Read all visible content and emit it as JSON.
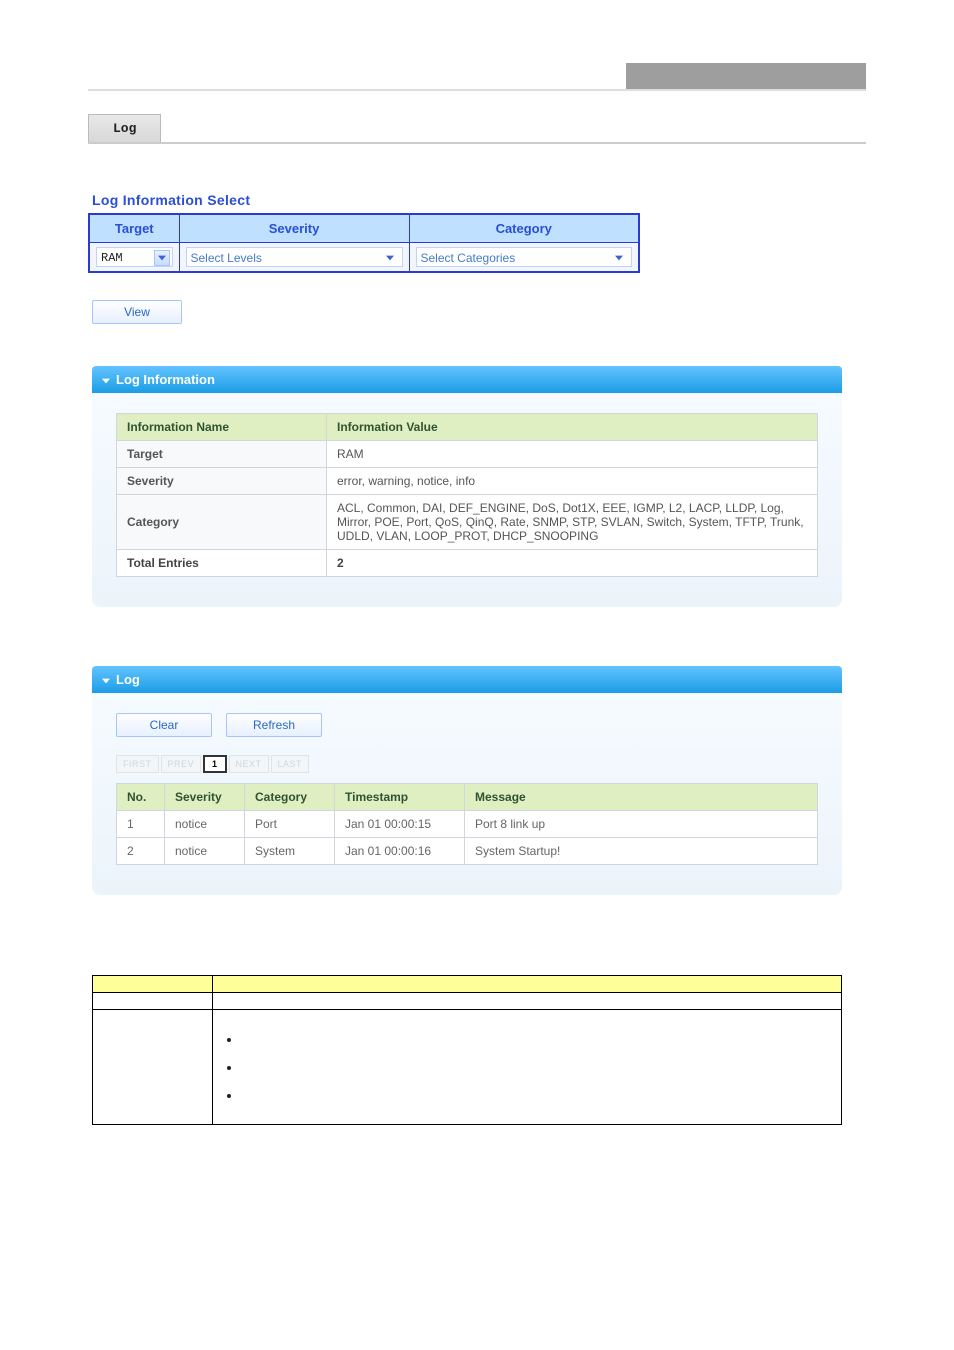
{
  "tab": {
    "label": "Log"
  },
  "logSelect": {
    "title": "Log Information Select",
    "headers": {
      "target": "Target",
      "severity": "Severity",
      "category": "Category"
    },
    "targetValue": "RAM",
    "severityPlaceholder": "Select Levels",
    "categoryPlaceholder": "Select Categories",
    "viewLabel": "View"
  },
  "infoPanel": {
    "title": "Log Information",
    "headers": {
      "name": "Information Name",
      "value": "Information Value"
    },
    "rows": [
      {
        "name": "Target",
        "value": "RAM"
      },
      {
        "name": "Severity",
        "value": "error, warning, notice, info"
      },
      {
        "name": "Category",
        "value": "ACL, Common, DAI, DEF_ENGINE, DoS, Dot1X, EEE, IGMP, L2, LACP, LLDP, Log, Mirror, POE, Port, QoS, QinQ, Rate, SNMP, STP, SVLAN, Switch, System, TFTP, Trunk, UDLD, VLAN, LOOP_PROT, DHCP_SNOOPING"
      }
    ],
    "totalLabel": "Total Entries",
    "totalValue": "2"
  },
  "logPanel": {
    "title": "Log",
    "clearLabel": "Clear",
    "refreshLabel": "Refresh",
    "pager": {
      "first": "FIRST",
      "prev": "PREV",
      "current": "1",
      "next": "NEXT",
      "last": "LAST"
    },
    "headers": {
      "no": "No.",
      "severity": "Severity",
      "category": "Category",
      "timestamp": "Timestamp",
      "message": "Message"
    },
    "rows": [
      {
        "no": "1",
        "severity": "notice",
        "category": "Port",
        "timestamp": "Jan 01 00:00:15",
        "message": "Port 8 link up"
      },
      {
        "no": "2",
        "severity": "notice",
        "category": "System",
        "timestamp": "Jan 01 00:00:16",
        "message": "System Startup!"
      }
    ]
  },
  "objTable": {
    "headers": {
      "object": "",
      "description": ""
    },
    "rows": [
      {
        "object": "",
        "description": ""
      },
      {
        "object": "",
        "bullets": [
          "",
          "",
          ""
        ]
      }
    ]
  }
}
